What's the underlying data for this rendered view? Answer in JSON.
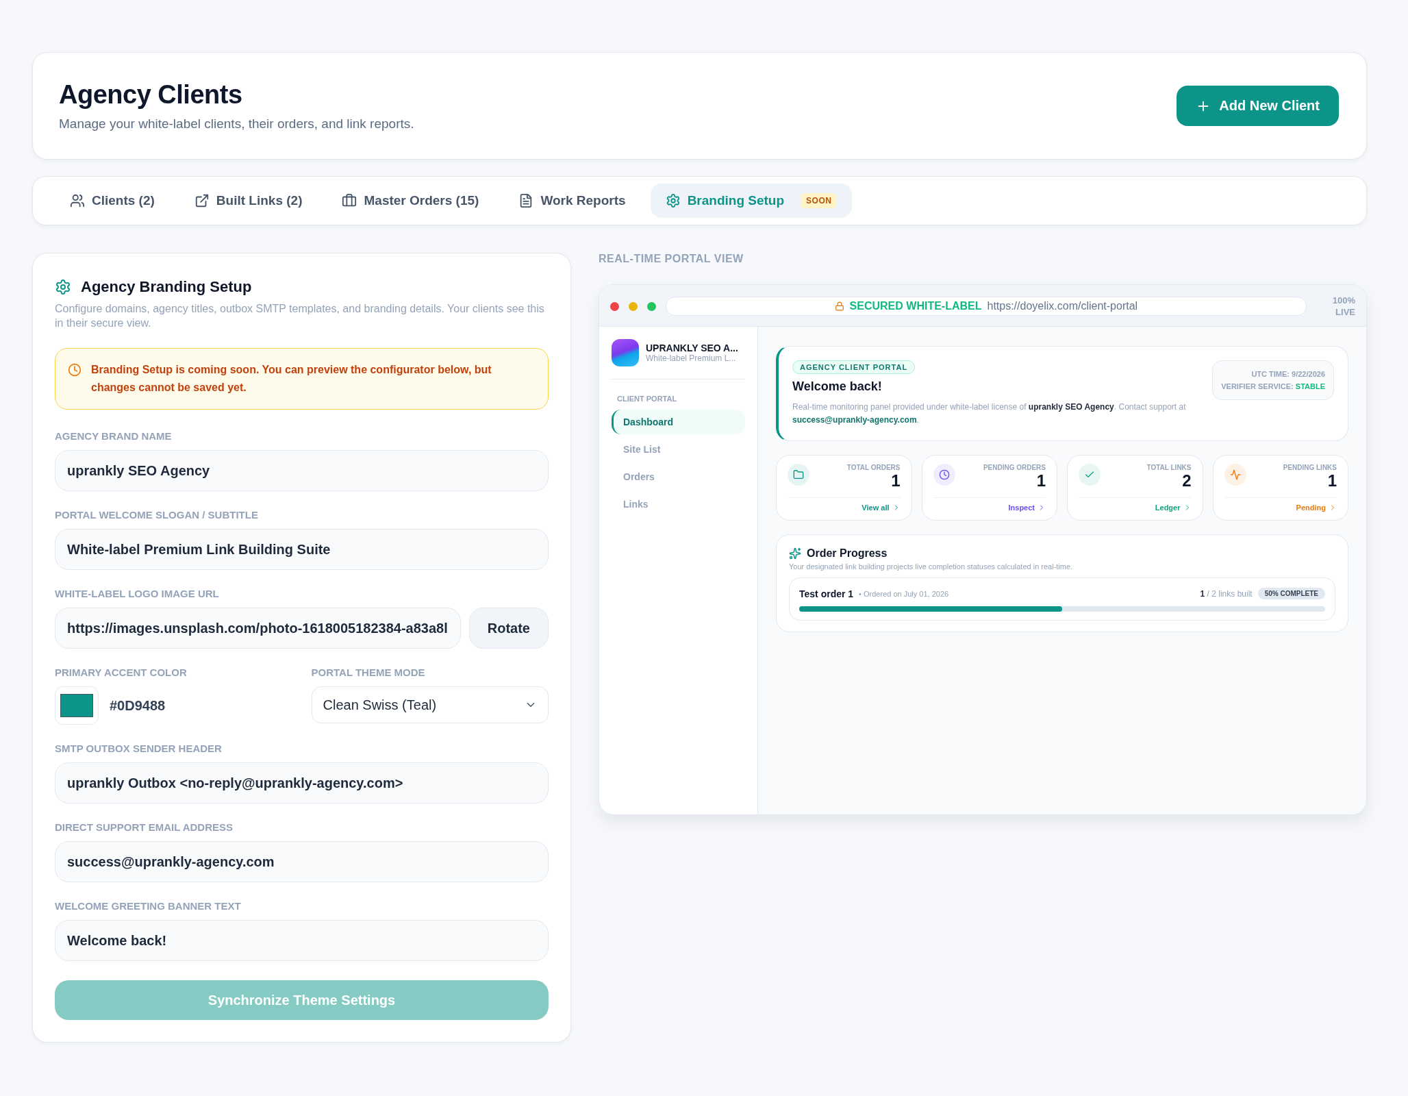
{
  "header": {
    "title": "Agency Clients",
    "subtitle": "Manage your white-label clients, their orders, and link reports.",
    "add_button": "Add New Client"
  },
  "tabs": [
    {
      "label": "Clients (2)",
      "selected": false
    },
    {
      "label": "Built Links (2)",
      "selected": false
    },
    {
      "label": "Master Orders (15)",
      "selected": false
    },
    {
      "label": "Work Reports",
      "selected": false
    },
    {
      "label": "Branding Setup",
      "selected": true,
      "badge": "SOON"
    }
  ],
  "branding": {
    "title": "Agency Branding Setup",
    "description": "Configure domains, agency titles, outbox SMTP templates, and branding details. Your clients see this in their secure view.",
    "notice": "Branding Setup is coming soon. You can preview the configurator below, but changes cannot be saved yet.",
    "fields": [
      {
        "kind": "text",
        "label": "AGENCY BRAND NAME",
        "value": "uprankly SEO Agency"
      },
      {
        "kind": "text",
        "label": "PORTAL WELCOME SLOGAN / SUBTITLE",
        "value": "White-label Premium Link Building Suite"
      },
      {
        "kind": "button",
        "label": "WHITE-LABEL LOGO IMAGE URL",
        "value": "https://images.unsplash.com/photo-1618005182384-a83a8l",
        "button": "Rotate"
      },
      {
        "kind": "pair",
        "left": {
          "label": "PRIMARY ACCENT COLOR",
          "value": "#0D9488",
          "color": "#0d9488"
        },
        "right": {
          "label": "PORTAL THEME MODE",
          "value": "Clean Swiss (Teal)"
        }
      },
      {
        "kind": "text",
        "label": "SMTP OUTBOX SENDER HEADER",
        "value": "uprankly Outbox <no-reply@uprankly-agency.com>"
      },
      {
        "kind": "text",
        "label": "DIRECT SUPPORT EMAIL ADDRESS",
        "value": "success@uprankly-agency.com"
      },
      {
        "kind": "text",
        "label": "WELCOME GREETING BANNER TEXT",
        "value": "Welcome back!"
      }
    ],
    "submit": {
      "label": "Synchronize Theme Settings",
      "disabled": true
    }
  },
  "preview": {
    "heading": "REAL-TIME PORTAL VIEW",
    "secure_label": "SECURED WHITE-LABEL",
    "url": "https://doyelix.com/client-portal",
    "zoom": "100%",
    "live": "LIVE",
    "brand": {
      "name": "UPRANKLY SEO A...",
      "slogan": "White-label Premium L..."
    },
    "nav_heading": "CLIENT PORTAL",
    "nav": [
      {
        "label": "Dashboard",
        "selected": true
      },
      {
        "label": "Site List",
        "selected": false
      },
      {
        "label": "Orders",
        "selected": false
      },
      {
        "label": "Links",
        "selected": false
      }
    ],
    "welcome": {
      "badge": "AGENCY CLIENT PORTAL",
      "title": "Welcome back!",
      "text": "Real-time monitoring panel provided under white-label license of **uprankly SEO Agency**. Contact support at ",
      "email": "success@uprankly-agency.com",
      "end": ".",
      "utc": "UTC TIME: 9/22/2026",
      "service_label": "VERIFIER SERVICE:",
      "service_status": "STABLE"
    },
    "stats": [
      {
        "label": "TOTAL ORDERS",
        "value": "1",
        "link": "View all",
        "color": "#0d9488"
      },
      {
        "label": "PENDING ORDERS",
        "value": "1",
        "link": "Inspect",
        "color": "#6d4cf6"
      },
      {
        "label": "TOTAL LINKS",
        "value": "2",
        "link": "Ledger",
        "color": "#10a37f"
      },
      {
        "label": "PENDING LINKS",
        "value": "1",
        "link": "Pending",
        "color": "#ea7a0c"
      }
    ],
    "progress": {
      "title": "Order Progress",
      "description": "Your designated link building projects live completion statuses calculated in real-time.",
      "orders": [
        {
          "name": "Test order 1",
          "date": "• Ordered on July 01, 2026",
          "built": "1",
          "total": "/ 2 links built",
          "badge": "50% COMPLETE",
          "level": 0.5
        }
      ]
    }
  }
}
